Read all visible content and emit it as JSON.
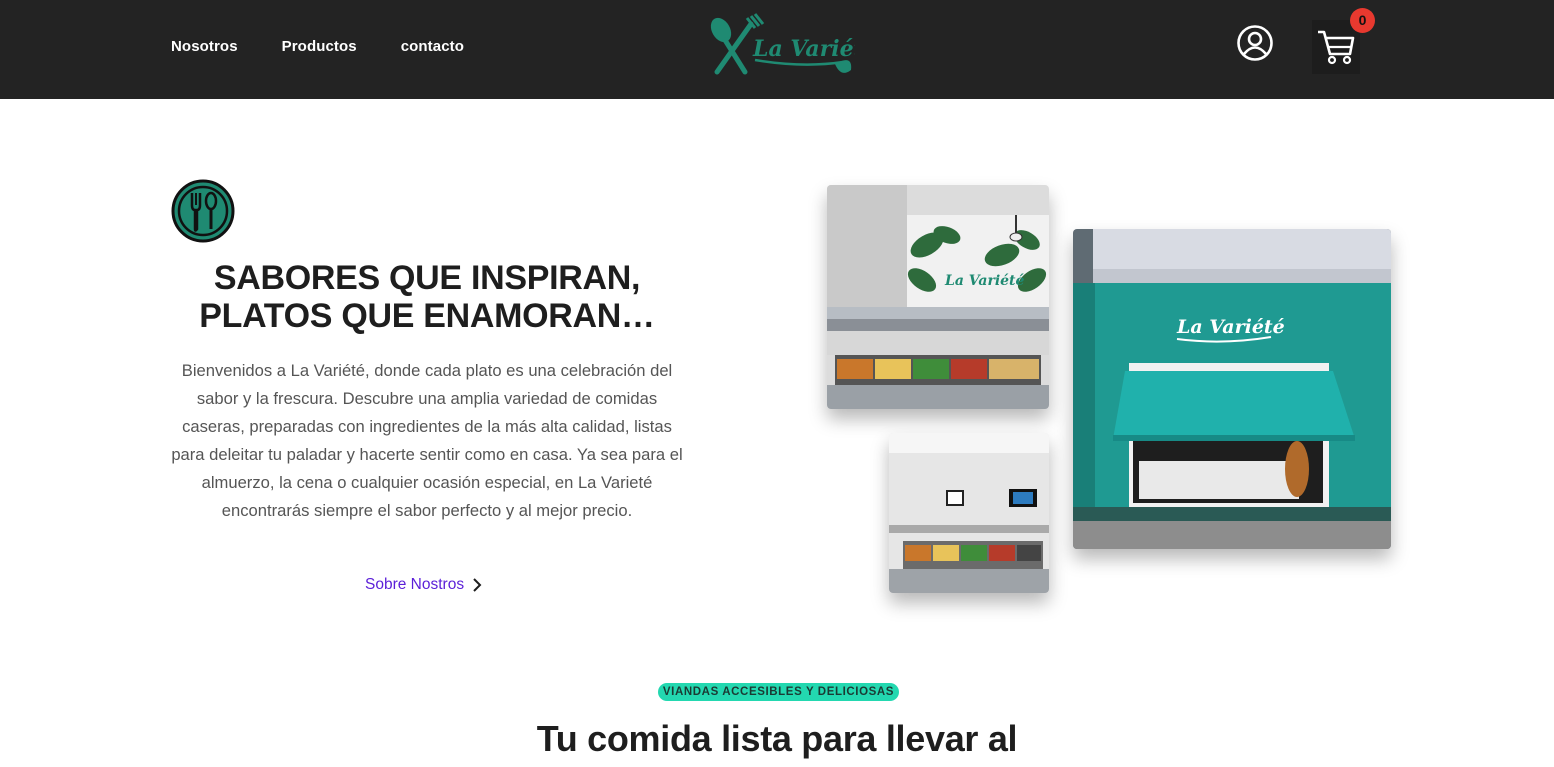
{
  "header": {
    "nav": [
      "Nosotros",
      "Productos",
      "contacto"
    ],
    "logo_text": "La Variété",
    "cart_count": "0",
    "icons": {
      "user": "user-circle-icon",
      "cart": "shopping-cart-icon"
    },
    "colors": {
      "background": "#232323",
      "brand": "#1f8a72",
      "badge": "#e8392f"
    }
  },
  "hero": {
    "icon": "cutlery-badge-icon",
    "title_line1": "SABORES QUE INSPIRAN,",
    "title_line2": "PLATOS QUE ENAMORAN…",
    "description": "Bienvenidos a La Variété, donde cada plato es una celebración del sabor y la frescura. Descubre una amplia variedad de comidas caseras, preparadas con ingredientes de la más alta calidad, listas para deleitar tu paladar y hacerte sentir como en casa. Ya sea para el almuerzo, la cena o cualquier ocasión especial, en La Varieté encontrarás siempre el sabor perfecto y al mejor precio.",
    "link_label": "Sobre Nostros",
    "link_icon": "chevron-right-icon",
    "link_color": "#5b1fd8"
  },
  "photos": {
    "buffet_sign": "La Variété",
    "storefront_sign": "La Variété"
  },
  "section": {
    "badge": "VIANDAS ACCESIBLES Y DELICIOSAS",
    "badge_color": "#23d8b0",
    "title": "Tu comida lista para llevar al"
  }
}
